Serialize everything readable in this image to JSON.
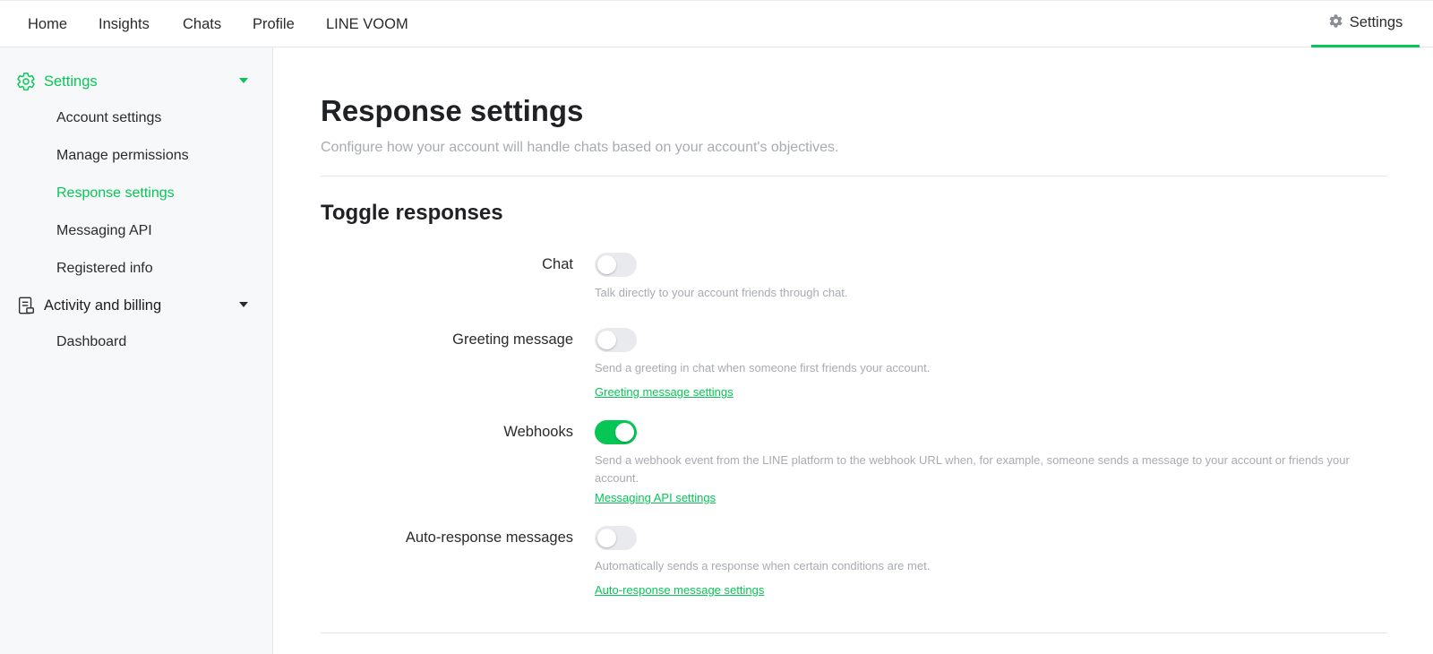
{
  "topnav": {
    "items": [
      "Home",
      "Insights",
      "Chats",
      "Profile",
      "LINE VOOM"
    ],
    "settings_label": "Settings"
  },
  "sidebar": {
    "settings_label": "Settings",
    "settings_items": [
      "Account settings",
      "Manage permissions",
      "Response settings",
      "Messaging API",
      "Registered info"
    ],
    "active_item": "Response settings",
    "billing_label": "Activity and billing",
    "billing_items": [
      "Dashboard"
    ]
  },
  "main": {
    "title": "Response settings",
    "subtitle": "Configure how your account will handle chats based on your account's objectives.",
    "section_title": "Toggle responses",
    "rows": [
      {
        "label": "Chat",
        "enabled": false,
        "description": "Talk directly to your account friends through chat.",
        "link": ""
      },
      {
        "label": "Greeting message",
        "enabled": false,
        "description": "Send a greeting in chat when someone first friends your account.",
        "link": "Greeting message settings"
      },
      {
        "label": "Webhooks",
        "enabled": true,
        "description": "Send a webhook event from the LINE platform to the webhook URL when, for example, someone sends a message to your account or friends your account.",
        "link": "Messaging API settings"
      },
      {
        "label": "Auto-response messages",
        "enabled": false,
        "description": "Automatically sends a response when certain conditions are met.",
        "link": "Auto-response message settings"
      }
    ]
  },
  "colors": {
    "accent": "#06c755",
    "muted_text": "#a8abb2",
    "sidebar_bg": "#f7f8fa",
    "toggle_off": "#e9eaed"
  },
  "icons": {
    "settings": "gear-icon",
    "billing": "receipt-icon",
    "caret": "caret-down-icon"
  }
}
